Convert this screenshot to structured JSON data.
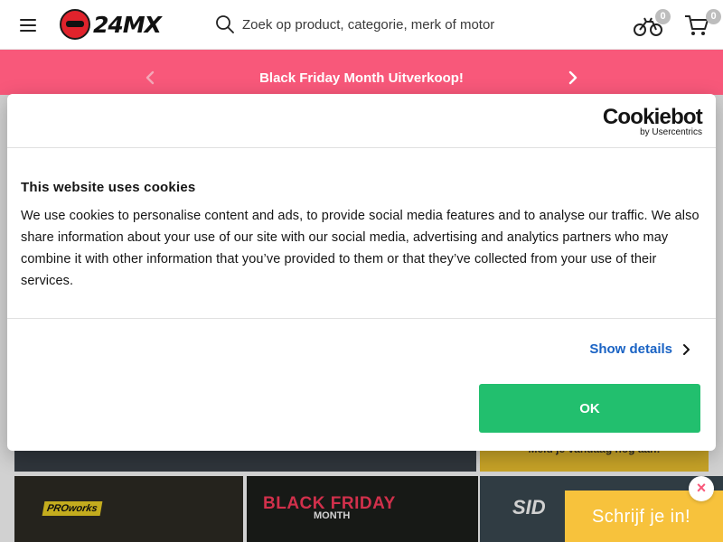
{
  "header": {
    "logo_text": "24MX",
    "search_placeholder": "Zoek op product, categorie, merk of motor",
    "garage_count": "0",
    "cart_count": "0"
  },
  "promo": {
    "text": "Black Friday Month Uitverkoop!"
  },
  "background": {
    "side_banner_text": "Meld je vandaag nog aan!",
    "tile1_label": "PROworks",
    "tile2_label": "BLACK FRIDAY",
    "tile2_sub": "MONTH",
    "tile3_label": "SID"
  },
  "cookie": {
    "brand": "Cookiebot",
    "brand_sub": "by Usercentrics",
    "title": "This website uses cookies",
    "body": "We use cookies to personalise content and ads, to provide social media features and to analyse our traffic. We also share information about your use of our site with our social media, advertising and analytics partners who may combine it with other information that you’ve provided to them or that they’ve collected from your use of their services.",
    "show_details": "Show details",
    "ok_label": "OK"
  },
  "newsletter": {
    "label": "Schrijf je in!",
    "close": "×"
  },
  "colors": {
    "promo_bg": "#f8587a",
    "ok_button": "#22bf6e",
    "link": "#1a63c4",
    "newsletter_bg": "#f7c23c"
  },
  "icons": [
    "menu-icon",
    "search-icon",
    "motorcycle-icon",
    "cart-icon",
    "chevron-left-icon",
    "chevron-right-icon"
  ]
}
